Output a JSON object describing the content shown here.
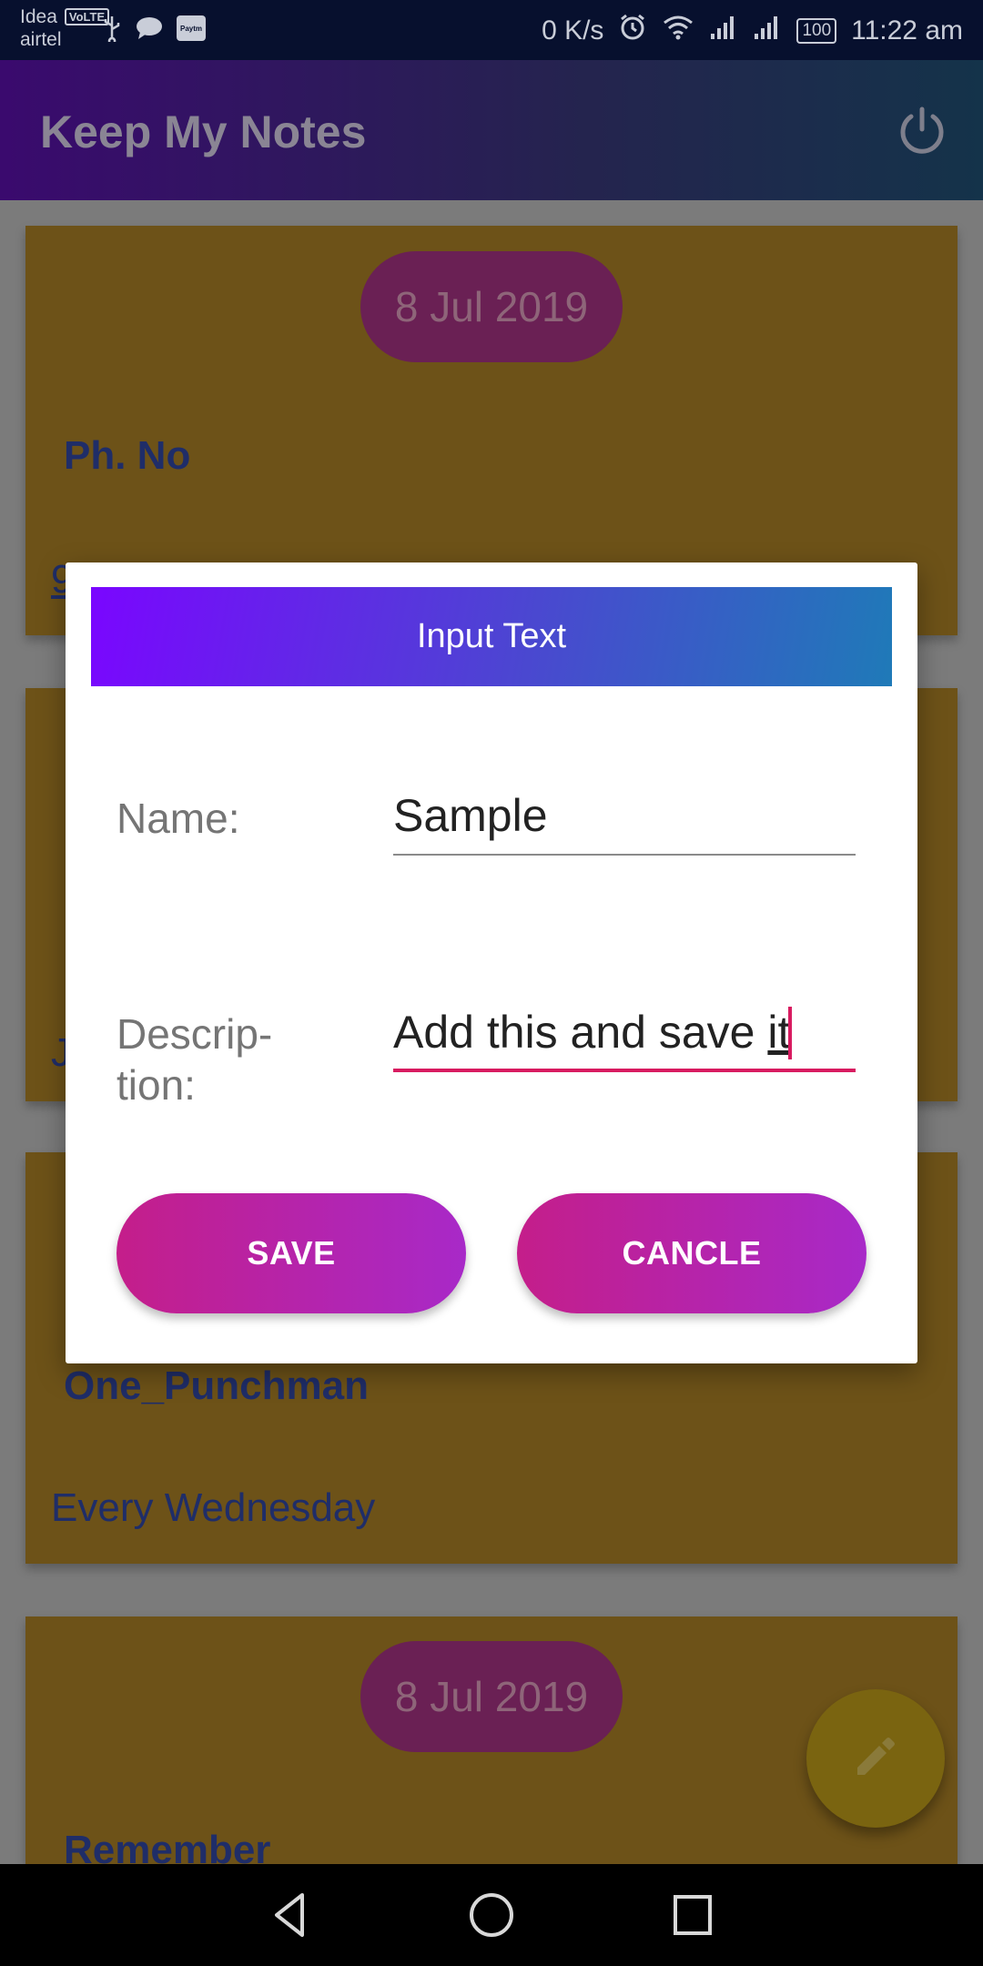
{
  "status_bar": {
    "carrier_1": "Idea",
    "volte_badge": "VoLTE",
    "carrier_2": "airtel",
    "paytm_label": "Paytm",
    "net_speed": "0 K/s",
    "battery": "100",
    "time": "11:22 am"
  },
  "app_bar": {
    "title": "Keep My Notes",
    "power_icon": "power-icon"
  },
  "notes": [
    {
      "date": "8 Jul 2019",
      "title": "Ph. No",
      "desc_fragment": "9"
    },
    {
      "desc_fragment": "J"
    },
    {
      "title": "One_Punchman",
      "desc": "Every Wednesday"
    },
    {
      "date": "8 Jul 2019",
      "title": "Remember"
    }
  ],
  "dialog": {
    "header": "Input Text",
    "name_label": "Name:",
    "name_value": "Sample",
    "desc_label_1": "Descrip-",
    "desc_label_2": "tion:",
    "desc_value_main": "Add this and save ",
    "desc_value_word": "it",
    "save_label": "SAVE",
    "cancel_label": "CANCLE",
    "accent": "#d81b60"
  },
  "fab": {
    "icon": "pencil-icon"
  },
  "nav_bar": {
    "icons": [
      "back-icon",
      "home-icon",
      "recents-icon"
    ]
  }
}
